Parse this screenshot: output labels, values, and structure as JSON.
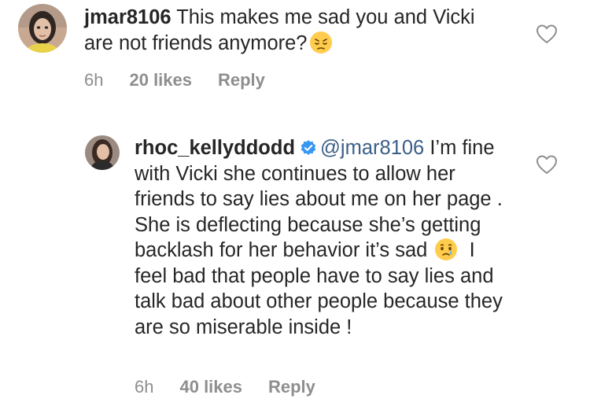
{
  "comments": [
    {
      "username": "jmar8106",
      "text": " This makes me sad you and Vicki are not friends anymore?",
      "emoji": "pensive-face-emoji",
      "time": "6h",
      "likes": "20 likes",
      "reply": "Reply",
      "avatar": "user-avatar-jmar8106"
    },
    {
      "username": "rhoc_kellyddodd",
      "verified": true,
      "mention": "@jmar8106",
      "text_before_emoji": " I’m fine with Vicki she continues to allow her friends to say lies about me on her page .  She is deflecting because she’s getting backlash for her behavior it’s sad ",
      "emoji": "crying-face-emoji",
      "text_after_emoji": "  I feel bad that people have to say lies and talk bad about other people because they are so miserable inside !",
      "time": "6h",
      "likes": "40 likes",
      "reply": "Reply",
      "avatar": "user-avatar-rhoc_kellyddodd"
    }
  ],
  "colors": {
    "text": "#262626",
    "meta": "#8e8e8e",
    "mention": "#3b5f88",
    "verified": "#3897f0"
  }
}
